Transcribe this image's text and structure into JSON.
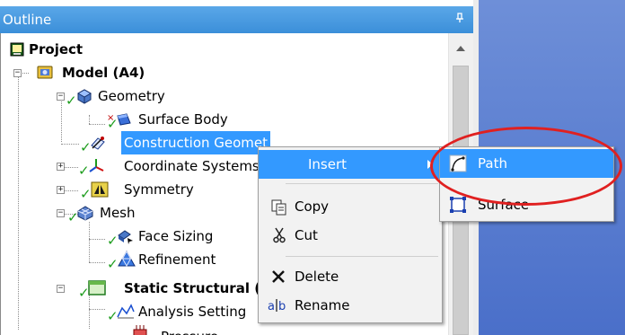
{
  "panel": {
    "title": "Outline",
    "pin_glyph": "ᵖ"
  },
  "tree": {
    "project": "Project",
    "model": "Model (A4)",
    "geometry": "Geometry",
    "surface_body": "Surface Body",
    "construction_geometry": "Construction Geomet",
    "coordinate_systems": "Coordinate Systems",
    "symmetry": "Symmetry",
    "mesh": "Mesh",
    "face_sizing": "Face Sizing",
    "refinement": "Refinement",
    "static_structural": "Static Structural (",
    "analysis_settings": "Analysis Setting",
    "pressure": "Pressure"
  },
  "context_menu": {
    "insert": "Insert",
    "copy": "Copy",
    "cut": "Cut",
    "delete": "Delete",
    "rename": "Rename"
  },
  "submenu": {
    "path": "Path",
    "surface": "Surface"
  },
  "colors": {
    "selection": "#3399ff",
    "titlebar": "#3b8fd9",
    "viewport": "#5a7ed0",
    "highlight_ring": "#e02020",
    "check": "#1e9d1e"
  }
}
